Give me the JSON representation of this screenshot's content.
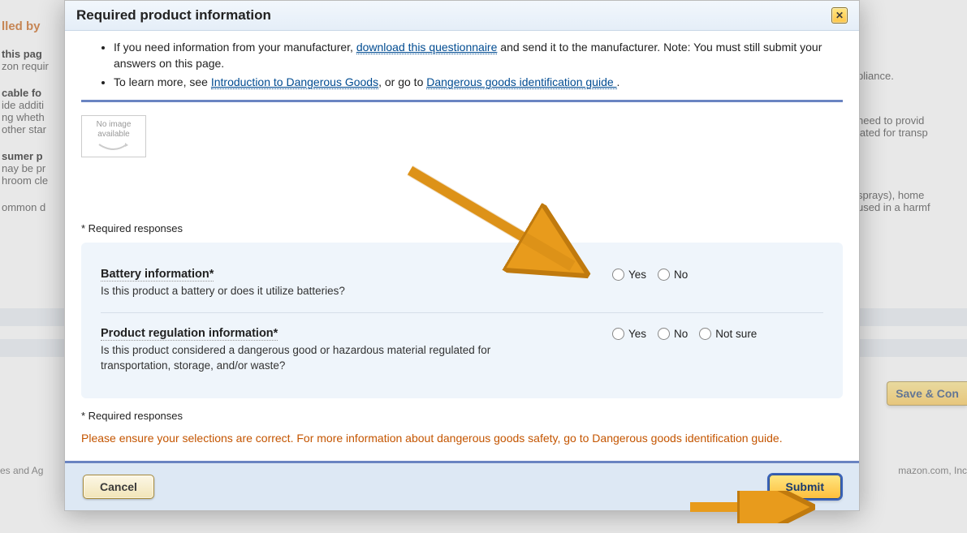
{
  "bg": {
    "leftHeader": "lled by",
    "leftBold1": "this pag",
    "leftLine1": "zon requir",
    "leftBold2": "cable fo",
    "leftLine2": "ide additi",
    "leftLine3": "ng wheth",
    "leftLine4": "other star",
    "leftBold3": "sumer p",
    "leftLine5": "nay be pr",
    "leftLine6": "hroom cle",
    "leftLine7": "ommon d",
    "rightLine1": "pliance.",
    "rightLine2": " need to provid",
    "rightLine3": "lated for transp",
    "rightLine4": " sprays), home",
    "rightLine5": "used in a harmf",
    "saveCon": "Save & Con",
    "footerRight": "mazon.com, Inc",
    "footerLeft": "es and Ag"
  },
  "dialog": {
    "title": "Required product information",
    "bullet1_prefix": "If you need information from your manufacturer, ",
    "bullet1_link": "download this questionnaire",
    "bullet1_suffix": " and send it to the manufacturer. Note: You must still submit your answers on this page.",
    "bullet2_prefix": "To learn more, see ",
    "bullet2_link1": "Introduction to Dangerous Goods",
    "bullet2_mid": ", or go to ",
    "bullet2_link2": "Dangerous goods identification guide ",
    "bullet2_suffix": ".",
    "noImage1": "No image",
    "noImage2": "available",
    "requiredNote": "* Required responses",
    "q1_title": "Battery information*",
    "q1_desc": "Is this product a battery or does it utilize batteries?",
    "q2_title": "Product regulation information*",
    "q2_desc": "Is this product considered a dangerous good or hazardous material regulated for transportation, storage, and/or waste?",
    "optYes": "Yes",
    "optNo": "No",
    "optNotSure": "Not sure",
    "requiredNote2": "* Required responses",
    "warning": "Please ensure your selections are correct. For more information about dangerous goods safety, go to Dangerous goods identification guide.",
    "cancel": "Cancel",
    "submit": "Submit"
  }
}
